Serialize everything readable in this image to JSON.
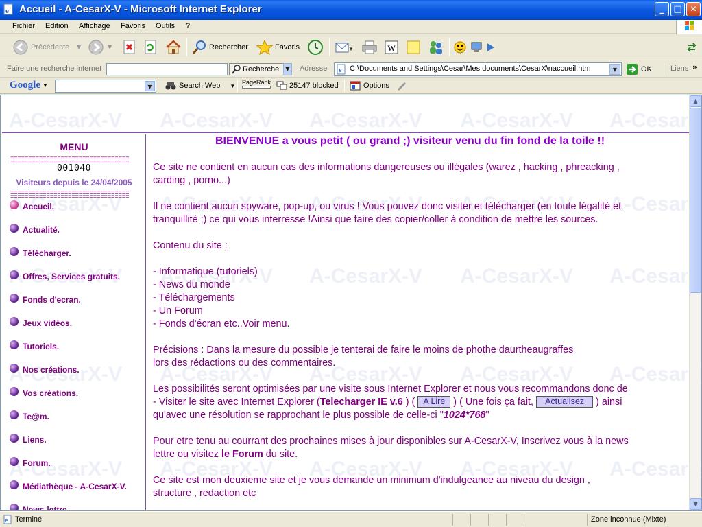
{
  "window": {
    "title": "Accueil - A-CesarX-V - Microsoft Internet Explorer",
    "controls": {
      "minimize": "_",
      "maximize": "□",
      "close": "✕"
    }
  },
  "menubar": {
    "items": [
      "Fichier",
      "Edition",
      "Affichage",
      "Favoris",
      "Outils",
      "?"
    ]
  },
  "toolbar": {
    "back": "Précédente",
    "search": "Rechercher",
    "favorites": "Favoris"
  },
  "addressbar": {
    "internet_search_label": "Faire une recherche internet",
    "search_button": "Recherche",
    "address_label": "Adresse",
    "address_value": "C:\\Documents and Settings\\Cesar\\Mes documents\\CesarX\\naccueil.htm",
    "go_button": "OK",
    "links_label": "Liens"
  },
  "googlebar": {
    "brand": "Google",
    "search_web": "Search Web",
    "pagerank": "PageRank",
    "blocked": "25147 blocked",
    "options": "Options"
  },
  "page": {
    "watermark": "A-CesarX-V",
    "menu_title": "MENU",
    "separator": "=================================",
    "counter": "001040",
    "visitors": "Visiteurs depuis le 24/04/2005",
    "nav": [
      "Accueil.",
      "Actualité.",
      "Télécharger.",
      "Offres, Services gratuits.",
      "Fonds d'ecran.",
      "Jeux vidéos.",
      "Tutoriels.",
      "Nos créations.",
      "Vos créations.",
      "Te@m.",
      "Liens.",
      "Forum.",
      "Médiathèque - A-CesarX-V.",
      "News-lettre."
    ],
    "headline": "BIENVENUE a vous petit ( ou grand ;) visiteur venu du fin fond de la toile !!",
    "p1a": "Ce site ne contient en aucun cas des informations dangereuses ou illégales (warez , hacking , phreacking ,",
    "p1b": "carding , porno...)",
    "p2a": "Il ne contient aucun spyware, pop-up, ou virus ! Vous pouvez donc visiter et télécharger (en toute légalité et",
    "p2b": "tranquillité ;) ce qui vous interresse !Ainsi que faire des copier/coller à condition de mettre les sources.",
    "contents_title": "Contenu du site :",
    "contents": [
      "- Informatique (tutoriels)",
      "- News du monde",
      "- Téléchargements",
      "- Un Forum",
      "- Fonds d'écran etc..Voir menu."
    ],
    "p4a": "Précisions : Dans la mesure du possible je tenterai de faire le moins de phothe daurtheaugraffes",
    "p4b": "lors des rédactions ou des commentaires.",
    "p5a": "Les possibilités seront optimisées par une visite sous Internet Explorer et nous vous recommandons donc de",
    "p5b_pre": "- Visiter le site avec Internet Explorer (",
    "ie_link": "Telecharger IE v.6",
    "p5b_mid1": " ) (",
    "btn_lire": "A Lire",
    "p5b_mid2": " ) ( Une fois ça fait,",
    "btn_refresh": "Actualisez",
    "p5b_post": " ) ainsi",
    "p5c_pre": "qu'avec une résolution se rapprochant le plus possible de celle-ci \"",
    "resolution": "1024*768",
    "p5c_post": "\"",
    "p6a": "Pour etre tenu au courrant des prochaines mises à jour disponibles sur A-CesarX-V, Inscrivez vous à la news",
    "p6b_pre": "lettre ou visitez ",
    "forum_link": "le Forum",
    "p6b_post": " du site.",
    "p7a": "Ce site est mon deuxieme site et je vous demande un minimum d'indulgeance au niveau du design ,",
    "p7b": "structure , redaction etc"
  },
  "statusbar": {
    "status": "Terminé",
    "zone": "Zone inconnue (Mixte)"
  }
}
